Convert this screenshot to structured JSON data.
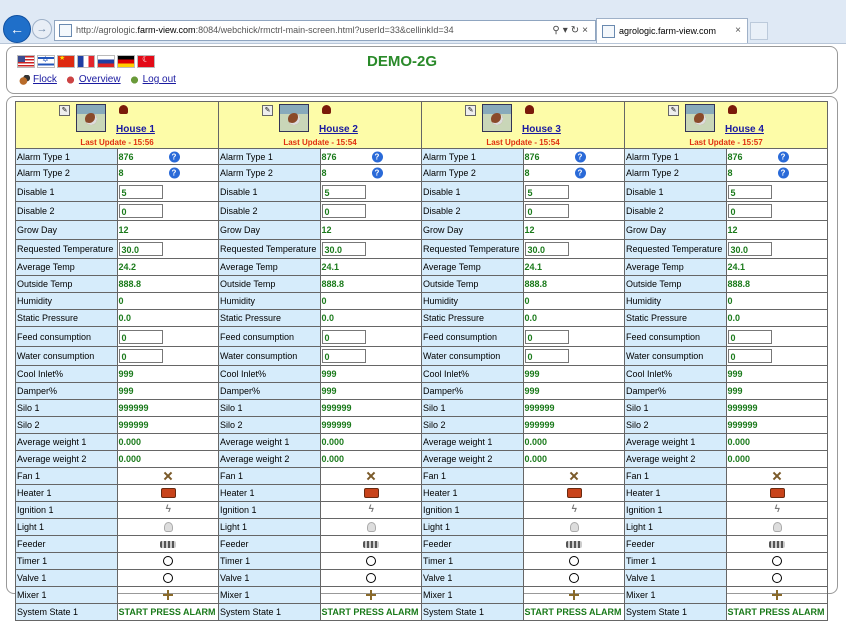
{
  "browser": {
    "url_prefix": "http://agrologic.",
    "url_domain": "farm-view.com",
    "url_suffix": ":8084/webchick/rmctrl-main-screen.html?userId=33&cellinkId=34",
    "tab_title": "agrologic.farm-view.com",
    "tab_close": "×"
  },
  "header": {
    "title": "DEMO-2G",
    "flags": [
      "us-flag",
      "il-flag",
      "cn-flag",
      "fr-flag",
      "ru-flag",
      "de-flag",
      "tr-flag"
    ],
    "links": {
      "flock": "Flock",
      "overview": "Overview",
      "logout": "Log out"
    }
  },
  "labels": [
    "Alarm Type 1",
    "Alarm Type 2",
    "Disable 1",
    "Disable 2",
    "Grow Day",
    "Requested Temperature",
    "Average Temp",
    "Outside Temp",
    "Humidity",
    "Static Pressure",
    "Feed consumption",
    "Water consumption",
    "Cool Inlet%",
    "Damper%",
    "Silo 1",
    "Silo 2",
    "Average weight 1",
    "Average weight 2",
    "Fan 1",
    "Heater 1",
    "Ignition 1",
    "Light 1",
    "Feeder",
    "Timer 1",
    "Valve 1",
    "Mixer 1",
    "System State 1"
  ],
  "houses": [
    {
      "name": "House 1",
      "last_update": "Last Update - 15:56",
      "values": [
        "876",
        "8",
        "5",
        "0",
        "12",
        "30.0",
        "24.2",
        "888.8",
        "0",
        "0.0",
        "0",
        "0",
        "999",
        "999",
        "999999",
        "999999",
        "0.000",
        "0.000",
        "START PRESS ALARM"
      ]
    },
    {
      "name": "House 2",
      "last_update": "Last Update - 15:54",
      "values": [
        "876",
        "8",
        "5",
        "0",
        "12",
        "30.0",
        "24.1",
        "888.8",
        "0",
        "0.0",
        "0",
        "0",
        "999",
        "999",
        "999999",
        "999999",
        "0.000",
        "0.000",
        "START PRESS ALARM"
      ]
    },
    {
      "name": "House 3",
      "last_update": "Last Update - 15:54",
      "values": [
        "876",
        "8",
        "5",
        "0",
        "12",
        "30.0",
        "24.1",
        "888.8",
        "0",
        "0.0",
        "0",
        "0",
        "999",
        "999",
        "999999",
        "999999",
        "0.000",
        "0.000",
        "START PRESS ALARM"
      ]
    },
    {
      "name": "House 4",
      "last_update": "Last Update - 15:57",
      "values": [
        "876",
        "8",
        "5",
        "0",
        "12",
        "30.0",
        "24.1",
        "888.8",
        "0",
        "0.0",
        "0",
        "0",
        "999",
        "999",
        "999999",
        "999999",
        "0.000",
        "0.000",
        "START PRESS ALARM"
      ]
    }
  ],
  "row_types": [
    "help",
    "help",
    "input",
    "input",
    "text",
    "input",
    "text",
    "text",
    "text",
    "text",
    "input",
    "input",
    "text",
    "text",
    "text",
    "text",
    "text",
    "text",
    "fan-icon",
    "heater-icon",
    "ignition-icon",
    "light-icon",
    "feeder-icon",
    "timer-icon",
    "valve-icon",
    "mixer-icon",
    "alarm"
  ],
  "row_heights": [
    15,
    16,
    19,
    18,
    18,
    18,
    16,
    16,
    16,
    16,
    19,
    18,
    16,
    16,
    16,
    16,
    16,
    16,
    16,
    16,
    16,
    16,
    16,
    16,
    16,
    16,
    16
  ]
}
